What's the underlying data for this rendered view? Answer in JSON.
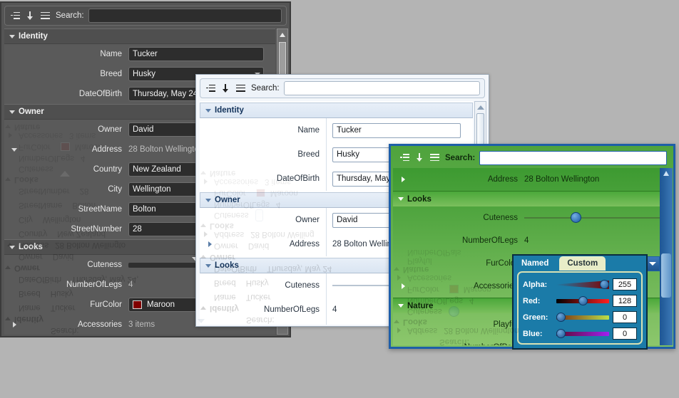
{
  "app": {
    "background_color": "#b4b4b4",
    "toolbar": {
      "search_label": "Search:",
      "search_value": "",
      "search_placeholder": "",
      "icons": [
        "categorized-view-icon",
        "sort-descending-icon",
        "flat-list-icon"
      ]
    }
  },
  "windows": {
    "dark": {
      "theme_name": "dark",
      "accent": "#2d2d2d",
      "toolbar": {
        "search_label": "Search:",
        "search_value": ""
      },
      "categories": [
        {
          "name": "Identity",
          "expanded": true,
          "rows": [
            {
              "label": "Name",
              "value": "Tucker",
              "type": "textbox"
            },
            {
              "label": "Breed",
              "value": "Husky",
              "type": "combobox"
            },
            {
              "label": "DateOfBirth",
              "value": "Thursday, May 24,",
              "type": "textbox"
            }
          ]
        },
        {
          "name": "Owner",
          "expanded": true,
          "rows": [
            {
              "label": "Owner",
              "value": "David",
              "type": "textbox"
            },
            {
              "label": "Address",
              "value": "28 Bolton Wellingto",
              "type": "plain",
              "expander": "down"
            },
            {
              "label": "Country",
              "value": "New Zealand",
              "type": "textbox"
            },
            {
              "label": "City",
              "value": "Wellington",
              "type": "textbox"
            },
            {
              "label": "StreetName",
              "value": "Bolton",
              "type": "textbox"
            },
            {
              "label": "StreetNumber",
              "value": "28",
              "type": "textbox"
            }
          ]
        },
        {
          "name": "Looks",
          "expanded": true,
          "rows": [
            {
              "label": "Cuteness",
              "value": "",
              "type": "slider",
              "slider_percent": 47
            },
            {
              "label": "NumberOfLegs",
              "value": "4",
              "type": "plain"
            },
            {
              "label": "FurColor",
              "value": "Maroon",
              "type": "color",
              "color": "#800000"
            },
            {
              "label": "Accessories",
              "value": "3 items",
              "type": "plain",
              "expander": "right"
            }
          ]
        },
        {
          "name": "Nature",
          "expanded": true,
          "rows": []
        }
      ]
    },
    "light": {
      "theme_name": "light",
      "accent": "#14345c",
      "toolbar": {
        "search_label": "Search:",
        "search_value": ""
      },
      "categories": [
        {
          "name": "Identity",
          "expanded": true,
          "rows": [
            {
              "label": "Name",
              "value": "Tucker",
              "type": "textbox"
            },
            {
              "label": "Breed",
              "value": "Husky",
              "type": "combobox"
            },
            {
              "label": "DateOfBirth",
              "value": "Thursday, May 24",
              "type": "textbox"
            }
          ]
        },
        {
          "name": "Owner",
          "expanded": true,
          "rows": [
            {
              "label": "Owner",
              "value": "David",
              "type": "textbox"
            },
            {
              "label": "Address",
              "value": "28 Bolton Welling",
              "type": "plain",
              "expander": "right"
            }
          ]
        },
        {
          "name": "Looks",
          "expanded": true,
          "rows": [
            {
              "label": "Cuteness",
              "value": "",
              "type": "slider",
              "slider_percent": 47
            },
            {
              "label": "NumberOfLegs",
              "value": "4",
              "type": "plain"
            },
            {
              "label": "FurColor",
              "value": "Maroon",
              "type": "color",
              "color": "#800000"
            },
            {
              "label": "Accessories",
              "value": "3 items",
              "type": "plain",
              "expander": "right"
            }
          ]
        },
        {
          "name": "Nature",
          "expanded": true,
          "rows": []
        }
      ]
    },
    "green": {
      "theme_name": "green",
      "accent": "#1e5fa8",
      "toolbar": {
        "search_label": "Search:",
        "search_value": ""
      },
      "categories": [
        {
          "name": "",
          "expanded": true,
          "rows": [
            {
              "label": "Address",
              "value": "28 Bolton Wellington",
              "type": "plain",
              "expander": "right"
            }
          ]
        },
        {
          "name": "Looks",
          "expanded": true,
          "rows": [
            {
              "label": "Cuteness",
              "value": "",
              "type": "slider",
              "slider_percent": 34
            },
            {
              "label": "NumberOfLegs",
              "value": "4",
              "type": "plain"
            },
            {
              "label": "FurColor",
              "value": "Maroon",
              "type": "color-combo",
              "color": "#800000"
            },
            {
              "label": "Accessories",
              "value": "",
              "type": "plain",
              "expander": "right"
            }
          ]
        },
        {
          "name": "Nature",
          "expanded": true,
          "rows": [
            {
              "label": "Playful",
              "value": "",
              "type": "plain"
            },
            {
              "label": "NumberOfPals",
              "value": "",
              "type": "plain"
            }
          ]
        }
      ]
    }
  },
  "color_picker": {
    "tabs": [
      {
        "label": "Named",
        "selected": true
      },
      {
        "label": "Custom",
        "selected": false
      }
    ],
    "channels": [
      {
        "label": "Alpha:",
        "value": "255",
        "percent": 100,
        "track": "alpha"
      },
      {
        "label": "Red:",
        "value": "128",
        "percent": 50,
        "track": "red"
      },
      {
        "label": "Green:",
        "value": "0",
        "percent": 0,
        "track": "green"
      },
      {
        "label": "Blue:",
        "value": "0",
        "percent": 0,
        "track": "blue"
      }
    ],
    "resulting_color": "#800000",
    "resulting_color_name": "Maroon"
  }
}
